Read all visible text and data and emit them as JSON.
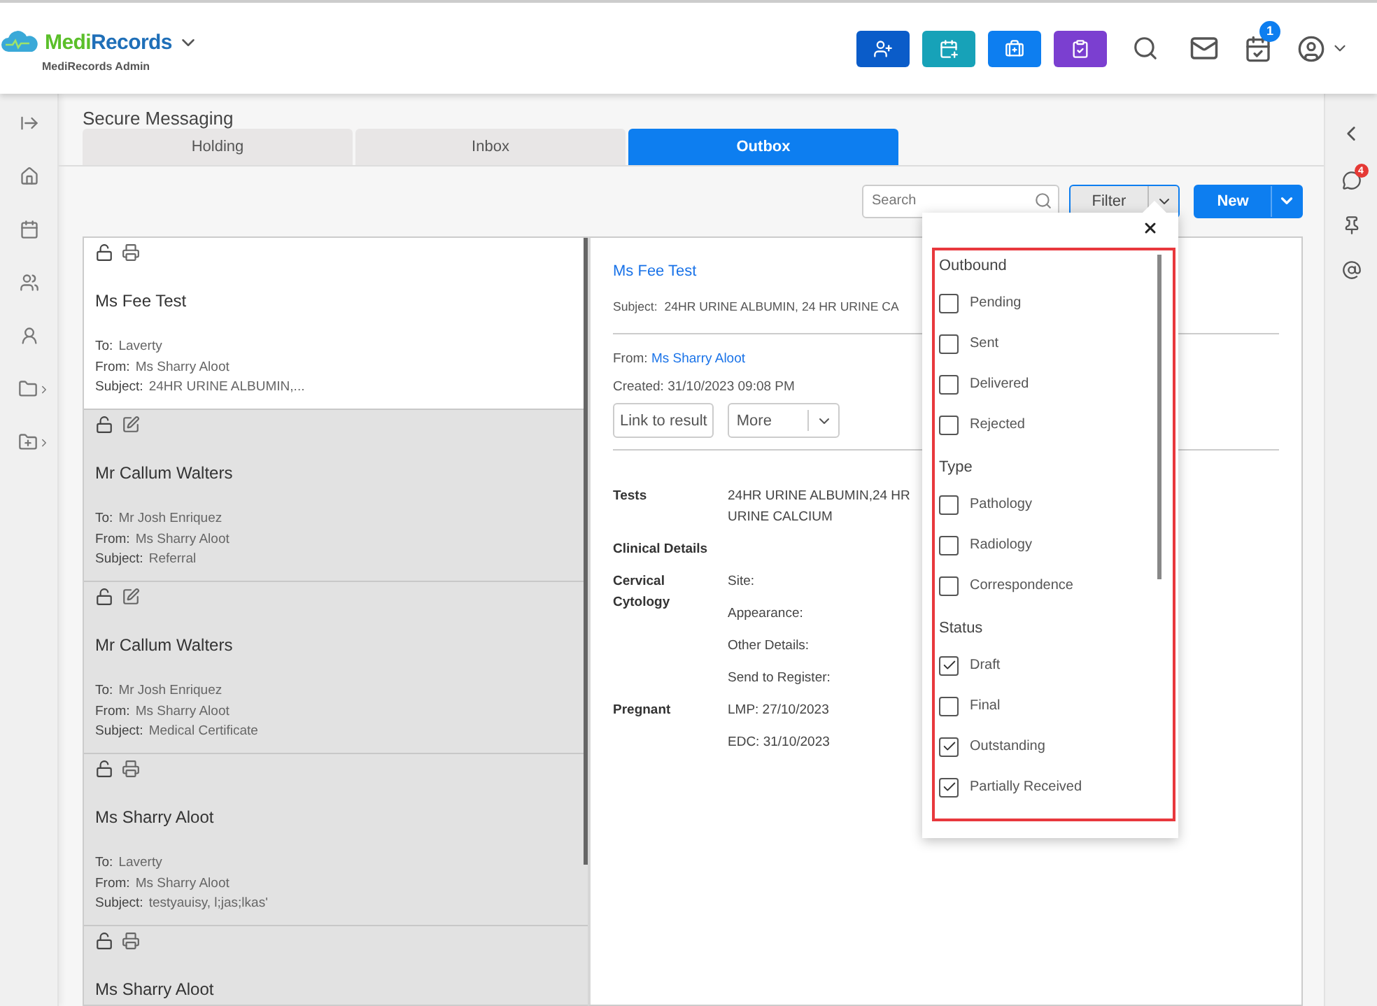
{
  "header": {
    "brand": [
      "Medi",
      "Records"
    ],
    "subtitle": "MediRecords Admin",
    "quick_actions": [
      {
        "kind": "add-patient",
        "color": "#0a5cc9"
      },
      {
        "kind": "appointment",
        "color": "#17a2b8"
      },
      {
        "kind": "clinical",
        "color": "#0d7ef0"
      },
      {
        "kind": "tasks",
        "color": "#7b3fd0"
      }
    ],
    "tasks_badge": "1"
  },
  "page_title": "Secure Messaging",
  "tabs": [
    {
      "label": "Holding",
      "selected": false
    },
    {
      "label": "Inbox",
      "selected": false
    },
    {
      "label": "Outbox",
      "selected": true
    }
  ],
  "toolbar": {
    "search": {
      "placeholder": "Search"
    },
    "filter_button": "Filter",
    "new_button": "New"
  },
  "messages": [
    {
      "selected": true,
      "kind": "result",
      "name": "Ms Fee Test",
      "to_label": "To:",
      "to": "Laverty",
      "from_label": "From:",
      "from": "Ms Sharry Aloot",
      "subject_label": "Subject:",
      "subject": "24HR URINE ALBUMIN,..."
    },
    {
      "selected": false,
      "kind": "draft",
      "name": "Mr Callum Walters",
      "to_label": "To:",
      "to": "Mr Josh Enriquez",
      "from_label": "From:",
      "from": "Ms Sharry Aloot",
      "subject_label": "Subject:",
      "subject": "Referral"
    },
    {
      "selected": false,
      "kind": "draft",
      "name": "Mr Callum Walters",
      "to_label": "To:",
      "to": "Mr Josh Enriquez",
      "from_label": "From:",
      "from": "Ms Sharry Aloot",
      "subject_label": "Subject:",
      "subject": "Medical Certificate"
    },
    {
      "selected": false,
      "kind": "result",
      "name": "Ms Sharry Aloot",
      "to_label": "To:",
      "to": "Laverty",
      "from_label": "From:",
      "from": "Ms Sharry Aloot",
      "subject_label": "Subject:",
      "subject": "testyauisy, l;jas;lkas'"
    },
    {
      "selected": false,
      "kind": "result",
      "name": "Ms Sharry Aloot"
    }
  ],
  "detail": {
    "patient": "Ms Fee Test",
    "subject_label": "Subject:",
    "subject": "24HR URINE ALBUMIN, 24 HR URINE CA",
    "from_label": "From:",
    "from": "Ms Sharry Aloot",
    "created_label": "Created:",
    "created": "31/10/2023 09:08 PM",
    "link_button": "Link to result",
    "more_button": "More",
    "fields": [
      {
        "label": "Tests",
        "values": [
          "24HR URINE ALBUMIN,24 HR URINE CALCIUM"
        ]
      },
      {
        "label": "Clinical Details"
      },
      {
        "label": "Cervical Cytology",
        "values": [
          "Site:",
          "Appearance:",
          "Other Details:",
          "Send to Register:"
        ]
      },
      {
        "label": "Pregnant",
        "values": [
          "LMP: 27/10/2023",
          "EDC: 31/10/2023"
        ]
      }
    ]
  },
  "filter_popup": {
    "groups": [
      {
        "heading": "Outbound",
        "options": [
          {
            "label": "Pending",
            "checked": false
          },
          {
            "label": "Sent",
            "checked": false
          },
          {
            "label": "Delivered",
            "checked": false
          },
          {
            "label": "Rejected",
            "checked": false
          }
        ]
      },
      {
        "heading": "Type",
        "options": [
          {
            "label": "Pathology",
            "checked": false
          },
          {
            "label": "Radiology",
            "checked": false
          },
          {
            "label": "Correspondence",
            "checked": false
          }
        ]
      },
      {
        "heading": "Status",
        "options": [
          {
            "label": "Draft",
            "checked": true
          },
          {
            "label": "Final",
            "checked": false
          },
          {
            "label": "Outstanding",
            "checked": true
          },
          {
            "label": "Partially Received",
            "checked": true
          }
        ]
      }
    ]
  },
  "right_rail": {
    "chat_badge": "4"
  }
}
